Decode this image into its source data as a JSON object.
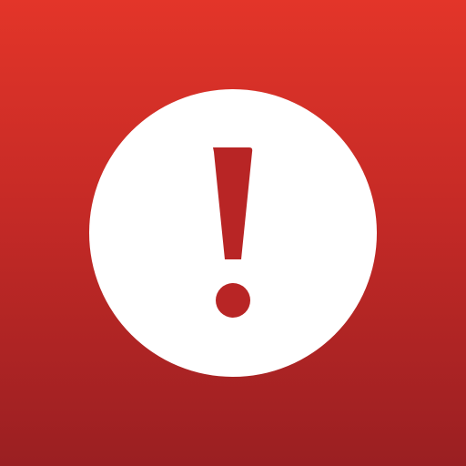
{
  "icon": {
    "name": "alert-icon",
    "symbol": "exclamation-mark-in-circle",
    "colors": {
      "background_top": "#E33529",
      "background_mid": "#C52A26",
      "background_bottom": "#9A1F22",
      "circle": "#FFFFFF",
      "mark": "#B82525"
    }
  }
}
